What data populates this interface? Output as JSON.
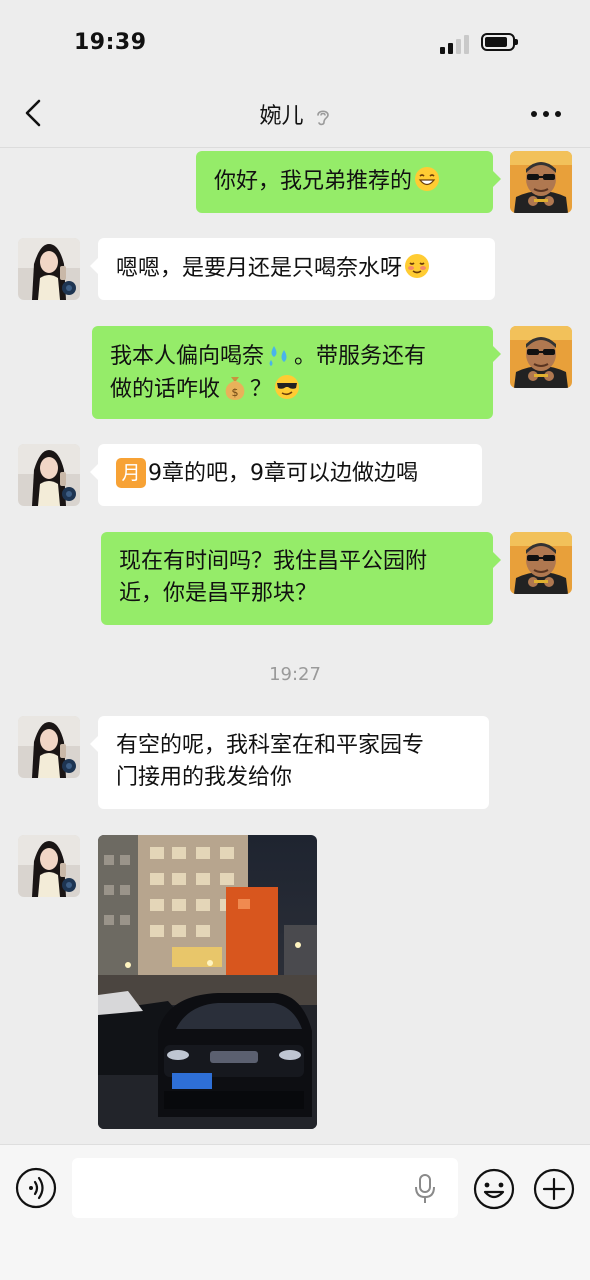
{
  "status_bar": {
    "time": "19:39",
    "signal_bars_active": 2,
    "signal_bars_total": 4,
    "battery_level": 0.85
  },
  "header": {
    "title": "婉儿",
    "back_icon": "chevron-left-icon",
    "more_icon": "more-dots-icon",
    "earpiece_icon": "ear-icon"
  },
  "messages": [
    {
      "side": "out",
      "text": "你好，我兄弟推荐的",
      "emoji": "grinning-face"
    },
    {
      "side": "in",
      "text": "嗯嗯，是要月还是只喝奈水呀",
      "emoji": "smirking-blush"
    },
    {
      "side": "out",
      "line1": "我本人偏向喝奈",
      "line1_tail": "。带服务还有",
      "line2": "做的话咋收",
      "line2_tail": "？",
      "emojis": [
        "sweat-droplets",
        "money-bag",
        "sunglasses-face"
      ]
    },
    {
      "side": "in",
      "badge": "月",
      "text": "9章的吧，9章可以边做边喝"
    },
    {
      "side": "out",
      "line1": "现在有时间吗？我住昌平公园附",
      "line2": "近，你是昌平那块？"
    },
    {
      "side": "in",
      "line1": "有空的呢，我科室在和平家园专",
      "line2": "门接用的我发给你"
    },
    {
      "side": "in",
      "type": "image",
      "subject": "night street with black SUV parked in front of apartment building"
    }
  ],
  "time_divider": "19:27",
  "input_bar": {
    "placeholder": "",
    "voice_icon": "voice-icon",
    "mic_icon": "mic-icon",
    "emoji_icon": "emoji-icon",
    "plus_icon": "plus-icon"
  },
  "colors": {
    "background": "#ededed",
    "outgoing_bubble": "#95ec69",
    "incoming_bubble": "#ffffff",
    "badge": "#f7a235"
  }
}
